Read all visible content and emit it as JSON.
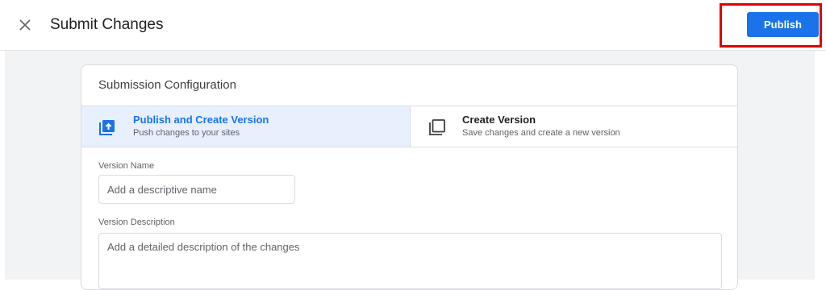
{
  "header": {
    "title": "Submit Changes",
    "close_icon": "close-icon",
    "publish_label": "Publish"
  },
  "card": {
    "title": "Submission Configuration",
    "options": [
      {
        "title": "Publish and Create Version",
        "subtitle": "Push changes to your sites",
        "icon": "publish-upload-icon",
        "selected": true
      },
      {
        "title": "Create Version",
        "subtitle": "Save changes and create a new version",
        "icon": "create-version-icon",
        "selected": false
      }
    ],
    "version_name": {
      "label": "Version Name",
      "placeholder": "Add a descriptive name",
      "value": ""
    },
    "version_description": {
      "label": "Version Description",
      "placeholder": "Add a detailed description of the changes",
      "value": ""
    }
  },
  "colors": {
    "accent": "#1a73e8",
    "selected_bg": "#e8f0fe",
    "highlight_border": "#e00000",
    "canvas_bg": "#f1f3f4"
  }
}
